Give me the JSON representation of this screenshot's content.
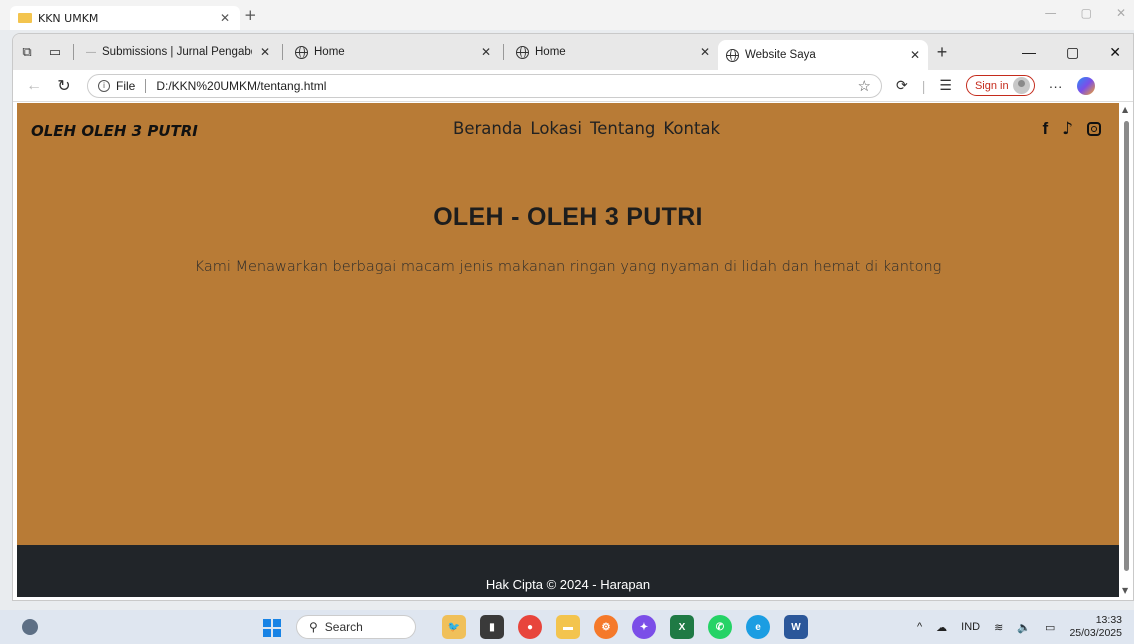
{
  "background_window": {
    "tab_title": "KKN UMKM"
  },
  "browser": {
    "tabs": [
      {
        "title": "Submissions | Jurnal Pengabdian",
        "active": false
      },
      {
        "title": "Home",
        "active": false
      },
      {
        "title": "Home",
        "active": false
      },
      {
        "title": "Website Saya",
        "active": true
      }
    ],
    "address": {
      "scheme_label": "File",
      "url": "D:/KKN%20UMKM/tentang.html"
    },
    "sign_in_label": "Sign in",
    "more_label": "···"
  },
  "site": {
    "brand": "OLEH OLEH 3 PUTRI",
    "nav": [
      "Beranda",
      "Lokasi",
      "Tentang",
      "Kontak"
    ],
    "social_icons": [
      "facebook-icon",
      "tiktok-icon",
      "instagram-icon"
    ],
    "hero_title": "OLEH - OLEH 3 PUTRI",
    "hero_subtitle": "Kami Menawarkan berbagai macam jenis makanan ringan yang nyaman di lidah dan hemat di kantong",
    "footer": "Hak Cipta © 2024 - Harapan",
    "colors": {
      "page_bg": "#b87b36",
      "footer_bg": "#212529"
    }
  },
  "taskbar": {
    "search_placeholder": "Search",
    "language": "IND",
    "time": "13:33",
    "date": "25/03/2025"
  }
}
